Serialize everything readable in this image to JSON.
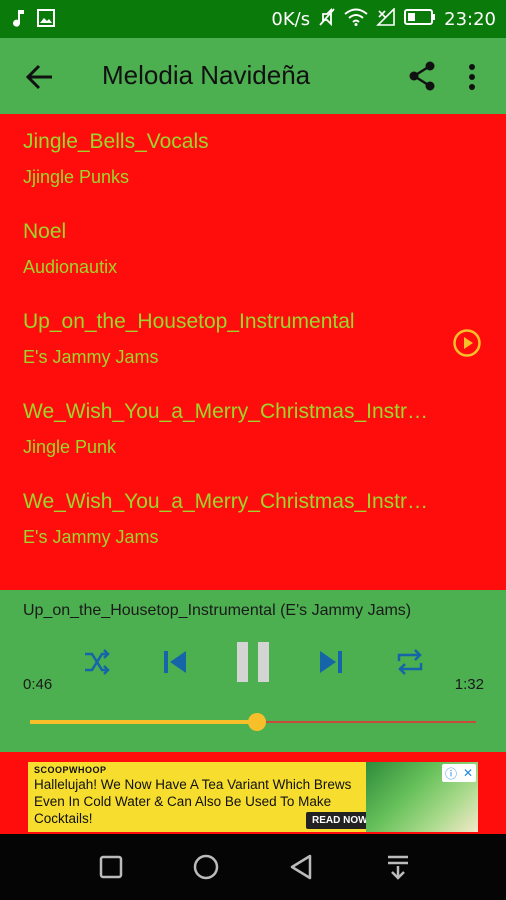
{
  "status_bar": {
    "network_speed": "0K/s",
    "time": "23:20"
  },
  "app_bar": {
    "title": "Melodia Navideña"
  },
  "songs": [
    {
      "title": "Jingle_Bells_Vocals",
      "artist": "Jjingle Punks",
      "playing": false
    },
    {
      "title": "Noel",
      "artist": "Audionautix",
      "playing": false
    },
    {
      "title": "Up_on_the_Housetop_Instrumental",
      "artist": "E's Jammy Jams",
      "playing": true
    },
    {
      "title": "We_Wish_You_a_Merry_Christmas_Instrumental",
      "artist": "Jingle Punk",
      "playing": false
    },
    {
      "title": "We_Wish_You_a_Merry_Christmas_Instrumental",
      "artist": "E's Jammy Jams",
      "playing": false
    }
  ],
  "player": {
    "now_playing": "Up_on_the_Housetop_Instrumental (E's Jammy Jams)",
    "time_current": "0:46",
    "time_total": "1:32",
    "progress": 0.51,
    "controls": [
      "shuffle-icon",
      "skip-previous-icon",
      "pause-icon",
      "skip-next-icon",
      "repeat-icon"
    ]
  },
  "ad": {
    "brand": "SCOOPWHOOP",
    "text": "Hallelujah! We Now Have A Tea Variant Which Brews Even In Cold Water & Can Also Be Used To Make Cocktails!",
    "cta": "READ NOW"
  },
  "colors": {
    "list_background": "#ff0d0d",
    "app_bar": "#4caf50",
    "status_bar": "#0a7a0a",
    "song_text": "#9cd62d",
    "accent": "#f7c02a"
  }
}
